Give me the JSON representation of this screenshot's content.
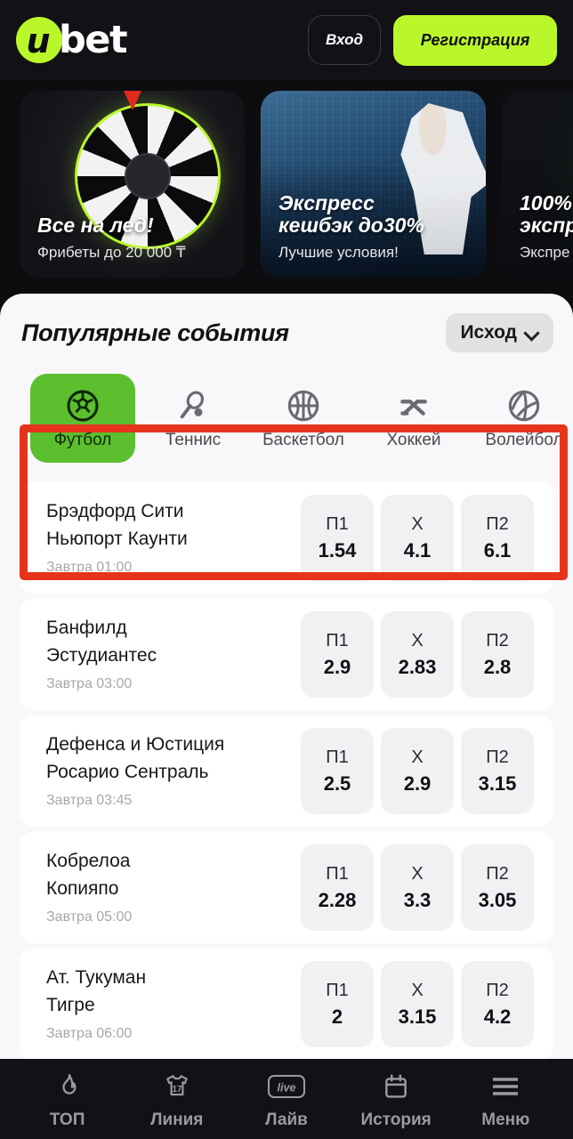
{
  "header": {
    "logo_mark": "u",
    "logo_word": "bet",
    "login_label": "Вход",
    "register_label": "Регистрация"
  },
  "banners": [
    {
      "title": "Все на лед!",
      "subtitle": "Фрибеты до 20 000 ₸",
      "art": "fortune-wheel"
    },
    {
      "title": "Экспресс\nкешбэк до30%",
      "title_line1": "Экспресс",
      "title_line2": "кешбэк до30%",
      "subtitle": "Лучшие условия!",
      "art": "tennis-photo"
    },
    {
      "title_line1": "100%",
      "title_line2": "экспр",
      "subtitle": "Экспре",
      "art": "cut-off-banner"
    }
  ],
  "section": {
    "title": "Популярные события",
    "outcome_filter": "Исход"
  },
  "sport_tabs": [
    {
      "label": "Футбол",
      "icon": "football-icon",
      "active": true
    },
    {
      "label": "Теннис",
      "icon": "tennis-icon",
      "active": false
    },
    {
      "label": "Баскетбол",
      "icon": "basketball-icon",
      "active": false
    },
    {
      "label": "Хоккей",
      "icon": "hockey-icon",
      "active": false
    },
    {
      "label": "Волейбол",
      "icon": "volleyball-icon",
      "active": false
    }
  ],
  "odds_keys": [
    "П1",
    "X",
    "П2"
  ],
  "matches": [
    {
      "home": "Брэдфорд Сити",
      "away": "Ньюпорт Каунти",
      "time": "Завтра 01:00",
      "odds": [
        {
          "key": "П1",
          "value": "1.54"
        },
        {
          "key": "X",
          "value": "4.1"
        },
        {
          "key": "П2",
          "value": "6.1"
        }
      ]
    },
    {
      "home": "Банфилд",
      "away": "Эстудиантес",
      "time": "Завтра 03:00",
      "odds": [
        {
          "key": "П1",
          "value": "2.9"
        },
        {
          "key": "X",
          "value": "2.83"
        },
        {
          "key": "П2",
          "value": "2.8"
        }
      ]
    },
    {
      "home": "Дефенса и Юстиция",
      "away": "Росарио Сентраль",
      "time": "Завтра 03:45",
      "odds": [
        {
          "key": "П1",
          "value": "2.5"
        },
        {
          "key": "X",
          "value": "2.9"
        },
        {
          "key": "П2",
          "value": "3.15"
        }
      ]
    },
    {
      "home": "Кобрелоа",
      "away": "Копияпо",
      "time": "Завтра 05:00",
      "odds": [
        {
          "key": "П1",
          "value": "2.28"
        },
        {
          "key": "X",
          "value": "3.3"
        },
        {
          "key": "П2",
          "value": "3.05"
        }
      ]
    },
    {
      "home": "Ат. Тукуман",
      "away": "Тигре",
      "time": "Завтра 06:00",
      "odds": [
        {
          "key": "П1",
          "value": "2"
        },
        {
          "key": "X",
          "value": "3.15"
        },
        {
          "key": "П2",
          "value": "4.2"
        }
      ]
    }
  ],
  "bottom_nav": [
    {
      "label": "ТОП",
      "icon": "flame-icon"
    },
    {
      "label": "Линия",
      "icon": "jersey-icon",
      "badge": "17"
    },
    {
      "label": "Лайв",
      "icon": "live-icon",
      "glyph": "live"
    },
    {
      "label": "История",
      "icon": "calendar-icon"
    },
    {
      "label": "Меню",
      "icon": "hamburger-icon"
    }
  ],
  "colors": {
    "brand_green": "#b9f72a",
    "active_tab_green": "#5cbf2e",
    "highlight_red": "#e5341b",
    "header_bg": "#121216",
    "sheet_bg": "#f8f8fa",
    "odd_bg": "#f1f1f4"
  }
}
